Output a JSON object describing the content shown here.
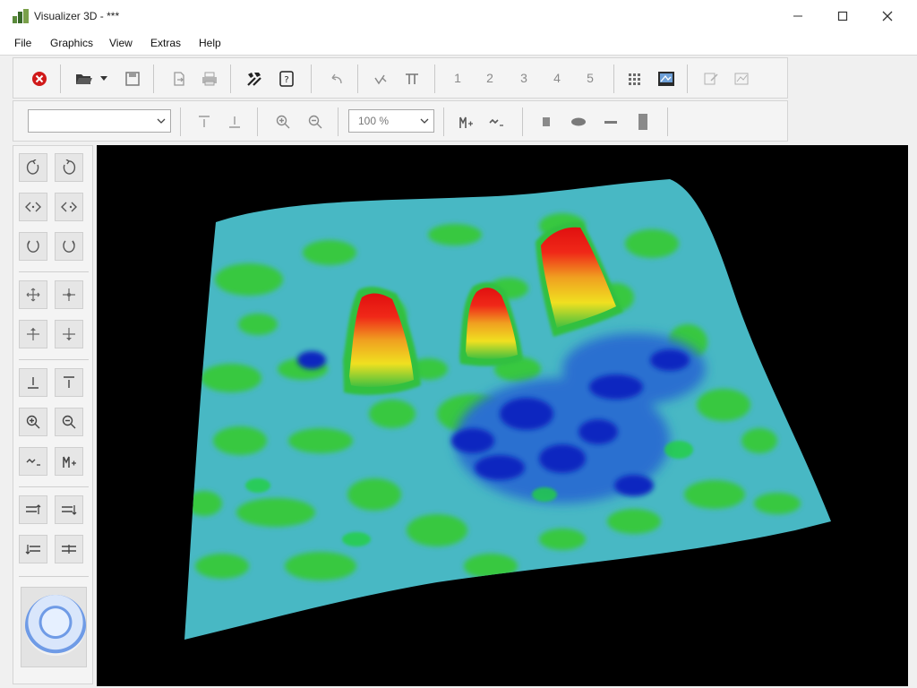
{
  "window": {
    "title": "Visualizer 3D - ***",
    "minimize_icon": "minimize-icon",
    "maximize_icon": "maximize-icon",
    "close_icon": "close-icon"
  },
  "menu": {
    "items": [
      "File",
      "Graphics",
      "View",
      "Extras",
      "Help"
    ]
  },
  "toolbar1": {
    "icons": [
      "close-red-icon",
      "folder-open-icon",
      "dropdown-arrow-icon",
      "save-icon",
      "export-icon",
      "print-icon",
      "tools-icon",
      "help-icon",
      "undo-icon",
      "redo-icon",
      "text-icon"
    ],
    "view_numbers": [
      "1",
      "2",
      "3",
      "4",
      "5"
    ],
    "end_icons": [
      "grid-icon",
      "scan-icon",
      "report-icon",
      "chart-icon"
    ]
  },
  "toolbar2": {
    "layer_select_value": "",
    "zoom_select_value": "100 %",
    "icons": [
      "align-top-icon",
      "align-bottom-icon",
      "zoom-in-icon",
      "zoom-out-icon",
      "marker-up-icon",
      "marker-down-icon",
      "rect-icon",
      "ellipse-icon",
      "line-icon",
      "bar-icon"
    ]
  },
  "sidepanel": {
    "buttons": [
      "rotate-left-icon",
      "rotate-right-icon",
      "tilt-left-icon",
      "tilt-right-icon",
      "spin-left-icon",
      "spin-right-icon",
      "pan-icon",
      "pan-alt-icon",
      "move-icon",
      "move-alt-icon",
      "floor-icon",
      "ceiling-icon",
      "zoom-in-icon",
      "zoom-out-icon",
      "marker-down-icon",
      "marker-up-icon",
      "raise-icon",
      "raise-alt-icon",
      "lower-icon",
      "lower-alt-icon"
    ],
    "navigator": "navigation-wheel"
  },
  "viewport": {
    "background": "#000000",
    "colors": {
      "low": "#1030c8",
      "mid": "#40b8c8",
      "base": "#38c848",
      "high_yellow": "#f0e020",
      "high_red": "#f01818"
    }
  }
}
